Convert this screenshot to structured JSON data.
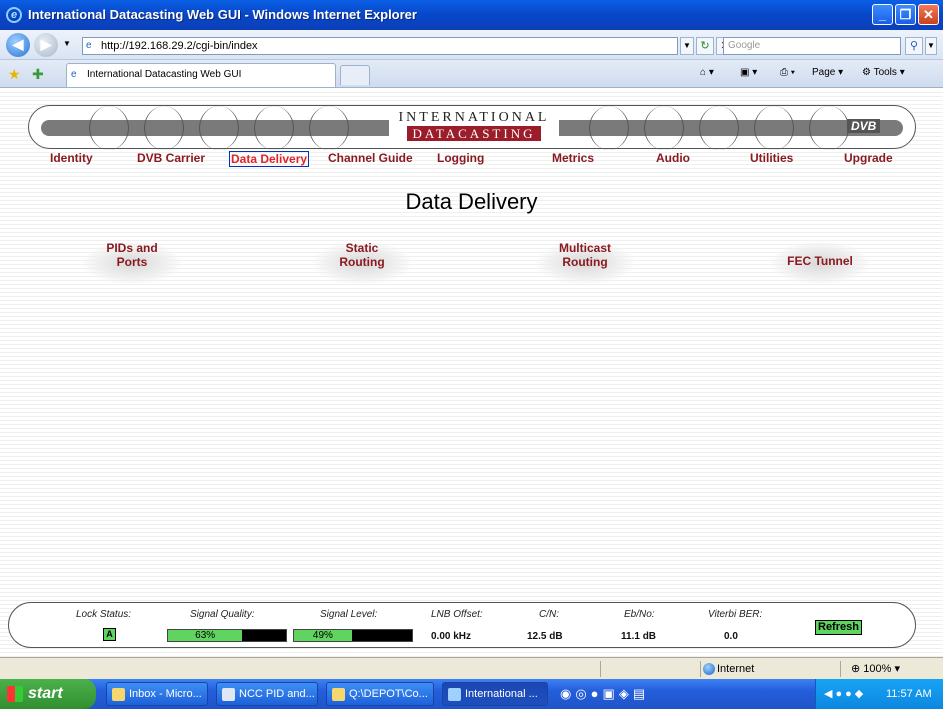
{
  "window": {
    "title": "International Datacasting Web GUI - Windows Internet Explorer"
  },
  "browser": {
    "url": "http://192.168.29.2/cgi-bin/index",
    "search_placeholder": "Google",
    "tab_title": "International Datacasting Web GUI",
    "page_menu": "Page",
    "tools_menu": "Tools"
  },
  "header": {
    "logo_line1": "INTERNATIONAL",
    "logo_line2": "DATACASTING",
    "dvb_logo": "DVB"
  },
  "nav": {
    "items": [
      "Identity",
      "DVB Carrier",
      "Data Delivery",
      "Channel Guide",
      "Logging",
      "Metrics",
      "Audio",
      "Utilities",
      "Upgrade"
    ],
    "active": "Data Delivery"
  },
  "page": {
    "title": "Data Delivery",
    "buttons": [
      {
        "line1": "PIDs and",
        "line2": "Ports"
      },
      {
        "line1": "Static",
        "line2": "Routing"
      },
      {
        "line1": "Multicast",
        "line2": "Routing"
      },
      {
        "line1": "FEC Tunnel",
        "line2": ""
      }
    ]
  },
  "status": {
    "lock_label": "Lock Status:",
    "lock_value": "A",
    "quality_label": "Signal Quality:",
    "quality_value": "63%",
    "quality_fraction": 0.63,
    "level_label": "Signal Level:",
    "level_value": "49%",
    "level_fraction": 0.49,
    "lnb_label": "LNB Offset:",
    "lnb_value": "0.00 kHz",
    "cn_label": "C/N:",
    "cn_value": "12.5 dB",
    "ebno_label": "Eb/No:",
    "ebno_value": "11.1 dB",
    "ber_label": "Viterbi BER:",
    "ber_value": "0.0",
    "refresh_label": "Refresh"
  },
  "statusbar": {
    "zone": "Internet",
    "zoom": "100%"
  },
  "taskbar": {
    "start_label": "start",
    "tasks": [
      "Inbox - Micro...",
      "NCC PID and...",
      "Q:\\DEPOT\\Co...",
      "International ..."
    ],
    "clock": "11:57 AM"
  }
}
